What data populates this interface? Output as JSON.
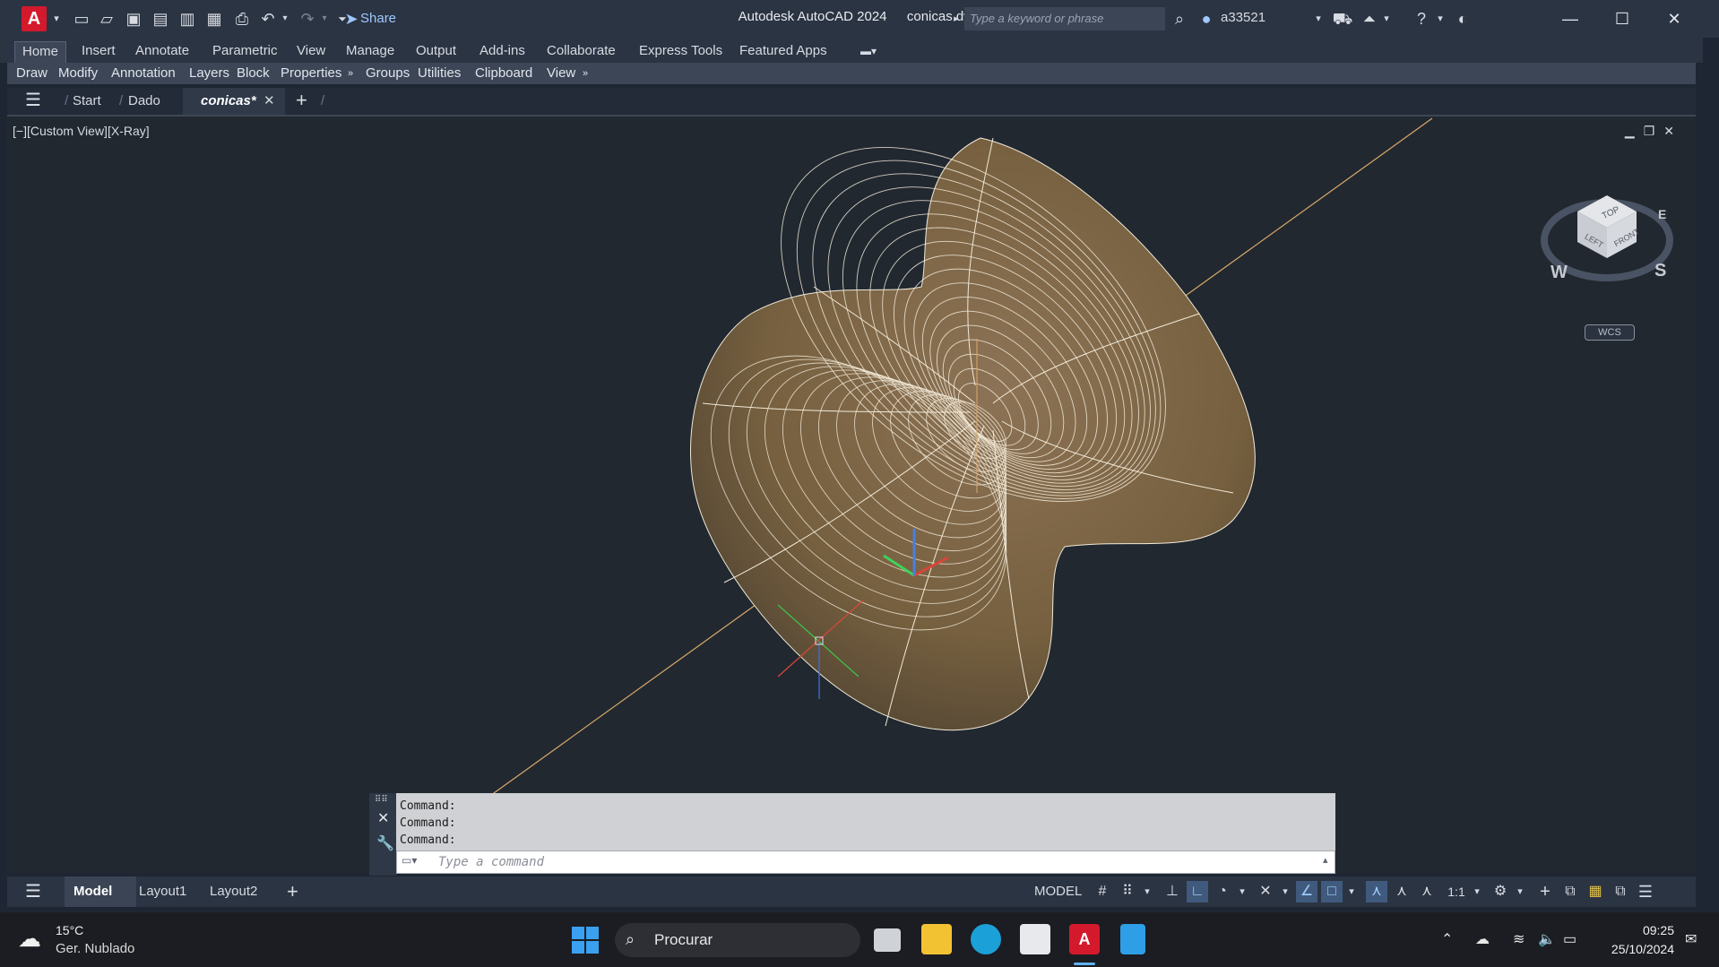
{
  "titlebar": {
    "app_logo": "A",
    "share_label": "Share",
    "app_title": "Autodesk AutoCAD 2024",
    "file_name": "conicas.dwg",
    "search_placeholder": "Type a keyword or phrase",
    "user_name": "a33521"
  },
  "ribbon": {
    "tabs": [
      "Home",
      "Insert",
      "Annotate",
      "Parametric",
      "View",
      "Manage",
      "Output",
      "Add-ins",
      "Collaborate",
      "Express Tools",
      "Featured Apps"
    ],
    "panels": [
      "Draw",
      "Modify",
      "Annotation",
      "Layers",
      "Block",
      "Properties",
      "Groups",
      "Utilities",
      "Clipboard",
      "View"
    ]
  },
  "doc_tabs": {
    "tabs": [
      "Start",
      "Dado",
      "conicas*"
    ]
  },
  "viewport": {
    "view_label": "[−][Custom View][X-Ray]",
    "viewcube_top": "TOP",
    "viewcube_left": "LEFT",
    "viewcube_front": "FRONT",
    "compass_w": "W",
    "compass_s": "S",
    "compass_e": "E",
    "wcs_label": "WCS"
  },
  "command": {
    "history": [
      "Command:",
      "Command:",
      "Command:"
    ],
    "placeholder": "Type a command"
  },
  "layout_tabs": [
    "Model",
    "Layout1",
    "Layout2"
  ],
  "status_bar": {
    "model_label": "MODEL",
    "scale_label": "1:1"
  },
  "taskbar": {
    "weather_temp": "15°C",
    "weather_desc": "Ger. Nublado",
    "search_label": "Procurar",
    "time": "09:25",
    "date": "25/10/2024"
  },
  "colors": {
    "surface": "#7a6047",
    "mesh_lines": "#f2ead8",
    "ucs_axis": "#d9a86a",
    "accent_red": "#d4192c"
  }
}
